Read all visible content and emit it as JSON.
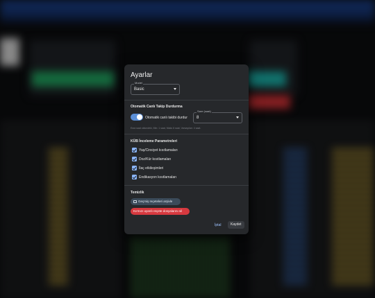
{
  "dialog": {
    "title": "Ayarlar",
    "model": {
      "label": "Model",
      "value": "Basic"
    },
    "auto_tracking": {
      "section_title": "Otomatik Canlı Takip Durdurma",
      "toggle_label": "Otomatik canlı takibi durdur",
      "toggle_on": true,
      "hours_select": {
        "label": "Sare (saat)",
        "value": "8"
      },
      "helper_text": "Esra saat oldundeki, Min: 1 saat, Maks 6 saat, Varsayılan: 4 saat."
    },
    "kub_params": {
      "section_title": "KÜB İnceleme Parametreleri",
      "items": [
        {
          "label": "Yaş/Cinsiyet kısıtlamaları",
          "checked": true
        },
        {
          "label": "Doz/Kür kısıtlamaları",
          "checked": true
        },
        {
          "label": "İlaç etkileşimleri",
          "checked": true
        },
        {
          "label": "Endikasyon kısıtlamaları",
          "checked": true
        }
      ]
    },
    "cleanup": {
      "section_title": "Temizlik",
      "archive_button": "Geçmiş reçeteleri arşivle",
      "delete_button": "Kırmızı uyarılı reçete dosyalarını sil"
    },
    "footer": {
      "cancel": "İptal",
      "save": "Kaydet"
    }
  },
  "colors": {
    "accent": "#8ab4f8",
    "toggle": "#5b8fd8",
    "danger": "#d6393f",
    "dialog_bg": "#26282b"
  }
}
